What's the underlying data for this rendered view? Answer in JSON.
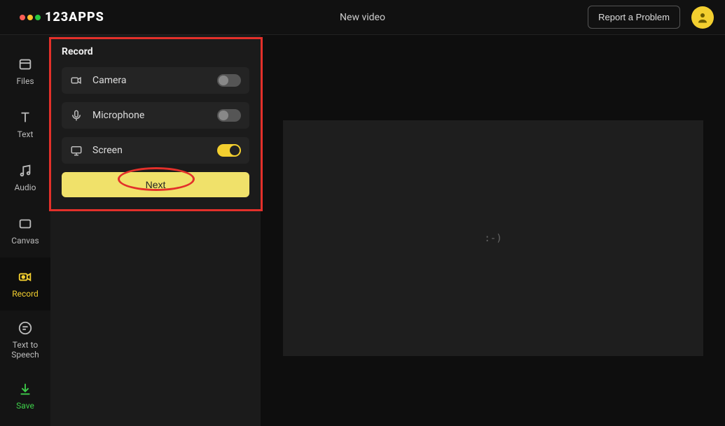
{
  "header": {
    "brand": "123APPS",
    "title": "New video",
    "report_label": "Report a Problem"
  },
  "sidebar": {
    "items": [
      {
        "id": "files",
        "label": "Files"
      },
      {
        "id": "text",
        "label": "Text"
      },
      {
        "id": "audio",
        "label": "Audio"
      },
      {
        "id": "canvas",
        "label": "Canvas"
      },
      {
        "id": "record",
        "label": "Record"
      },
      {
        "id": "tts",
        "label": "Text to Speech"
      },
      {
        "id": "save",
        "label": "Save"
      }
    ],
    "active": "record"
  },
  "panel": {
    "title": "Record",
    "options": [
      {
        "id": "camera",
        "label": "Camera",
        "enabled": false
      },
      {
        "id": "microphone",
        "label": "Microphone",
        "enabled": false
      },
      {
        "id": "screen",
        "label": "Screen",
        "enabled": true
      }
    ],
    "next_label": "Next"
  },
  "canvas": {
    "placeholder": ":-)"
  },
  "colors": {
    "accent_yellow": "#f3cf2f",
    "accent_green": "#3ecf4a",
    "annotation_red": "#e3302a"
  }
}
